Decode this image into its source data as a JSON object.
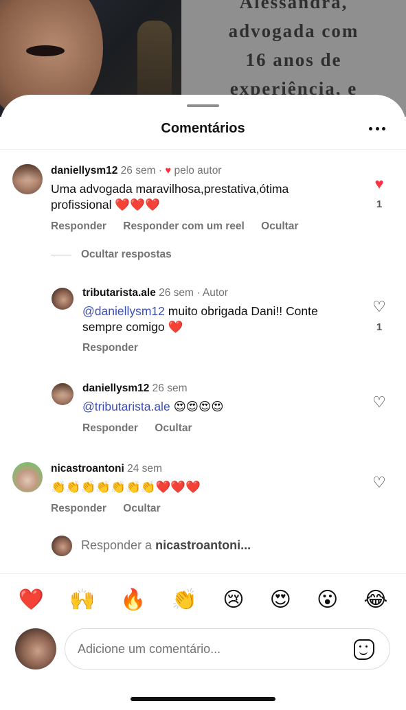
{
  "post": {
    "caption_lines": [
      "Alessandra,",
      "advogada com",
      "16 anos de",
      "experiência, e"
    ]
  },
  "sheet": {
    "title": "Comentários"
  },
  "comments": [
    {
      "username": "daniellysm12",
      "time": "26 sem",
      "author_badge": "pelo autor",
      "text": "Uma advogada maravilhosa,prestativa,ótima profissional ❤️❤️❤️",
      "actions": [
        "Responder",
        "Responder com um reel",
        "Ocultar"
      ],
      "likes": "1",
      "liked": true
    },
    {
      "username": "tributarista.ale",
      "time": "26 sem",
      "role": "Autor",
      "mention": "@daniellysm12",
      "text": "muito obrigada Dani!! Conte sempre comigo ❤️",
      "actions": [
        "Responder"
      ],
      "likes": "1"
    },
    {
      "username": "daniellysm12",
      "time": "26 sem",
      "mention": "@tributarista.ale",
      "text": "😍😍😍😍",
      "actions": [
        "Responder",
        "Ocultar"
      ]
    },
    {
      "username": "nicastroantoni",
      "time": "24 sem",
      "text": "👏👏👏👏👏👏👏❤️❤️❤️",
      "actions": [
        "Responder",
        "Ocultar"
      ]
    }
  ],
  "hide_replies": "Ocultar respostas",
  "reply_bar": {
    "prefix": "Responder a",
    "target": "nicastroantoni..."
  },
  "emoji_bar": [
    "❤️",
    "🙌",
    "🔥",
    "👏",
    "😢",
    "😍",
    "😮",
    "😂"
  ],
  "composer": {
    "placeholder": "Adicione um comentário..."
  },
  "separators": {
    "dot": "·"
  },
  "icons": {
    "heart_filled": "♥",
    "heart_outline": "♡"
  }
}
